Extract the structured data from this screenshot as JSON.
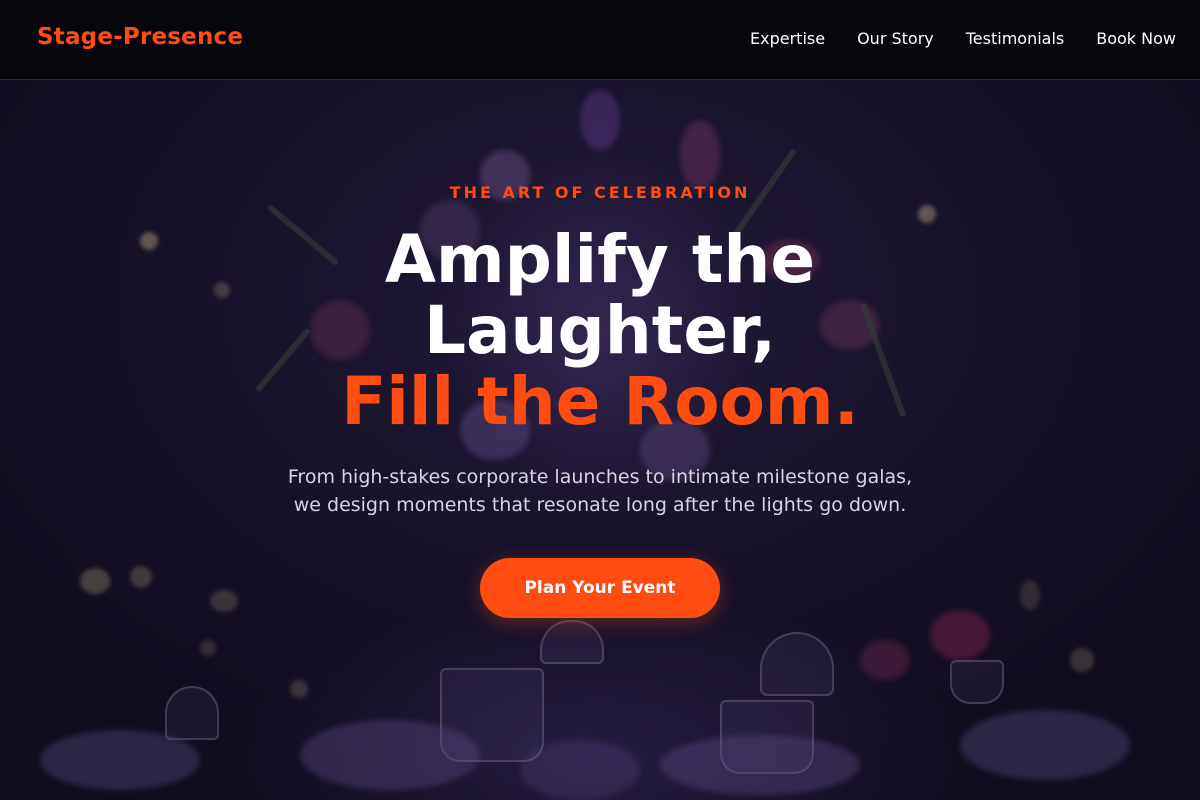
{
  "header": {
    "brand": "Stage-Presence",
    "nav": [
      {
        "label": "Expertise"
      },
      {
        "label": "Our Story"
      },
      {
        "label": "Testimonials"
      },
      {
        "label": "Book Now"
      }
    ]
  },
  "hero": {
    "eyebrow": "THE ART OF CELEBRATION",
    "headline_line1": "Amplify the",
    "headline_line2": "Laughter,",
    "headline_accent": "Fill the Room.",
    "subtext_line1": "From high-stakes corporate launches to intimate milestone galas,",
    "subtext_line2": "we design moments that resonate long after the lights go down.",
    "cta_label": "Plan Your Event"
  },
  "colors": {
    "accent": "#ff4d12",
    "header_bg": "#07060c",
    "hero_bg": "#1c1631",
    "text_primary": "#ffffff"
  }
}
